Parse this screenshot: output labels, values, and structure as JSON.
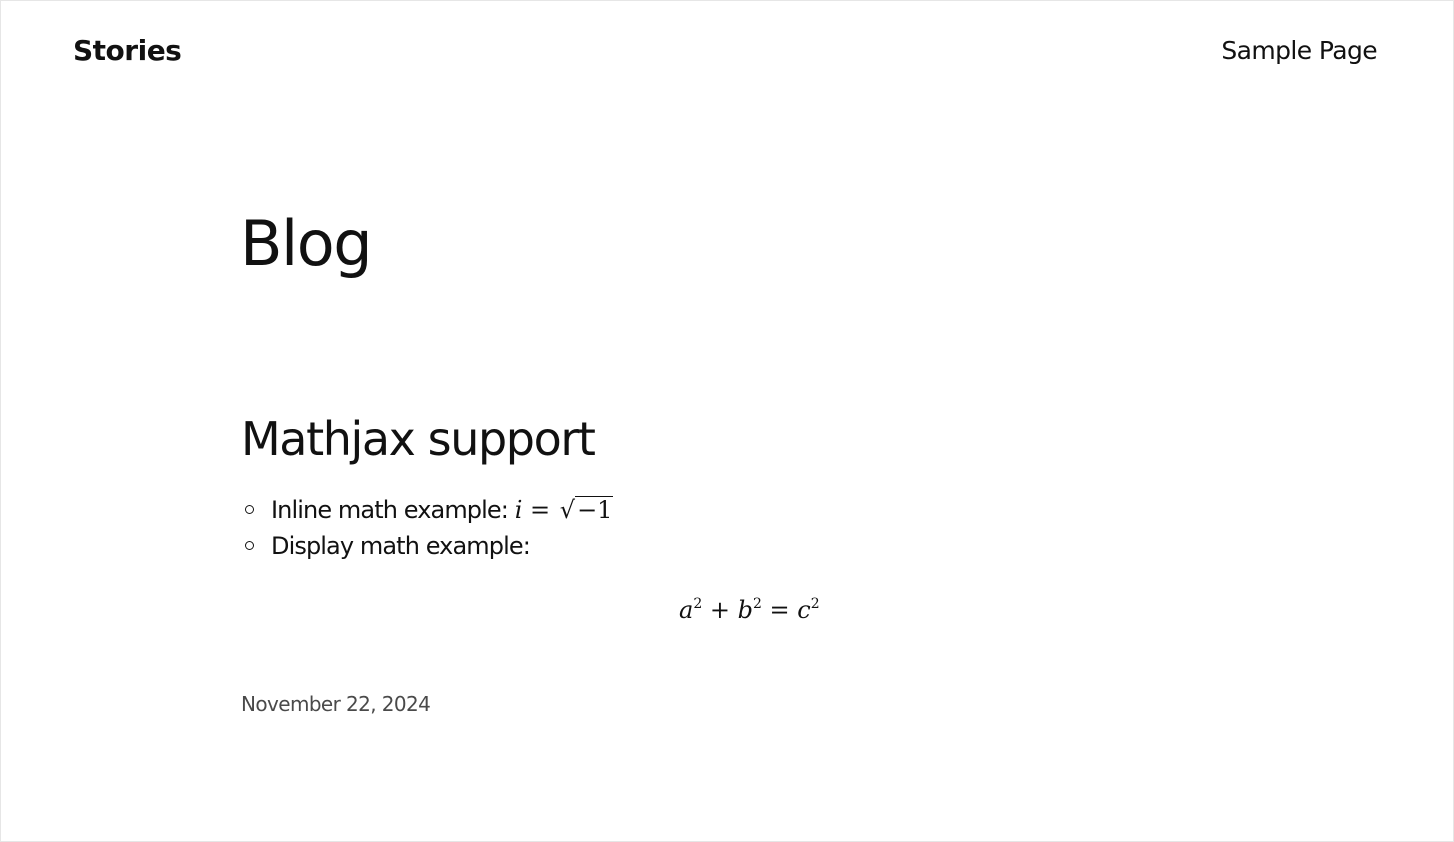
{
  "header": {
    "site_title": "Stories",
    "nav": [
      {
        "label": "Sample Page"
      }
    ]
  },
  "main": {
    "page_title": "Blog",
    "post": {
      "title": "Mathjax support",
      "items": [
        {
          "label": "Inline math example:",
          "math": "i = √−1"
        },
        {
          "label": "Display math example:"
        }
      ],
      "display_math": "a² + b² = c²",
      "date": "November 22, 2024"
    }
  },
  "colors": {
    "text": "#111111",
    "muted": "#4a4a4a",
    "background": "#ffffff",
    "border": "#e6e6e6"
  }
}
